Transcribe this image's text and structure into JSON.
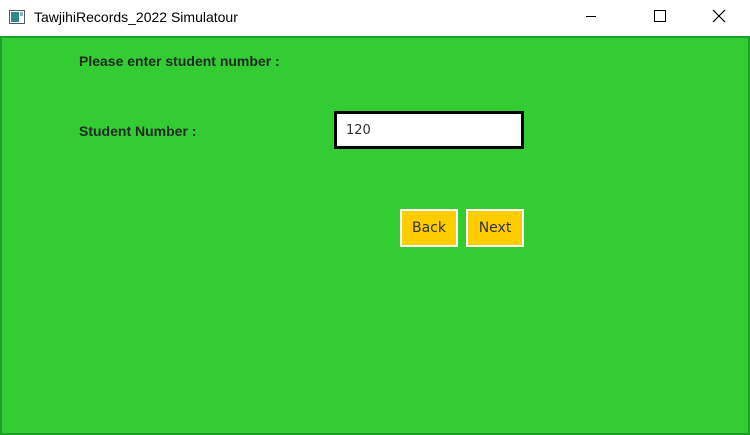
{
  "window": {
    "title": "TawjihiRecords_2022 Simulatour",
    "controls": {
      "minimize_icon": "minimize-icon",
      "maximize_icon": "maximize-icon",
      "close_icon": "close-icon"
    }
  },
  "form": {
    "prompt": "Please enter student number :",
    "student_number_label": "Student Number :",
    "student_number_value": "120",
    "back_label": "Back",
    "next_label": "Next"
  },
  "colors": {
    "background": "#33cc33",
    "button": "#ffcc00",
    "label_text": "#1e2a22"
  }
}
